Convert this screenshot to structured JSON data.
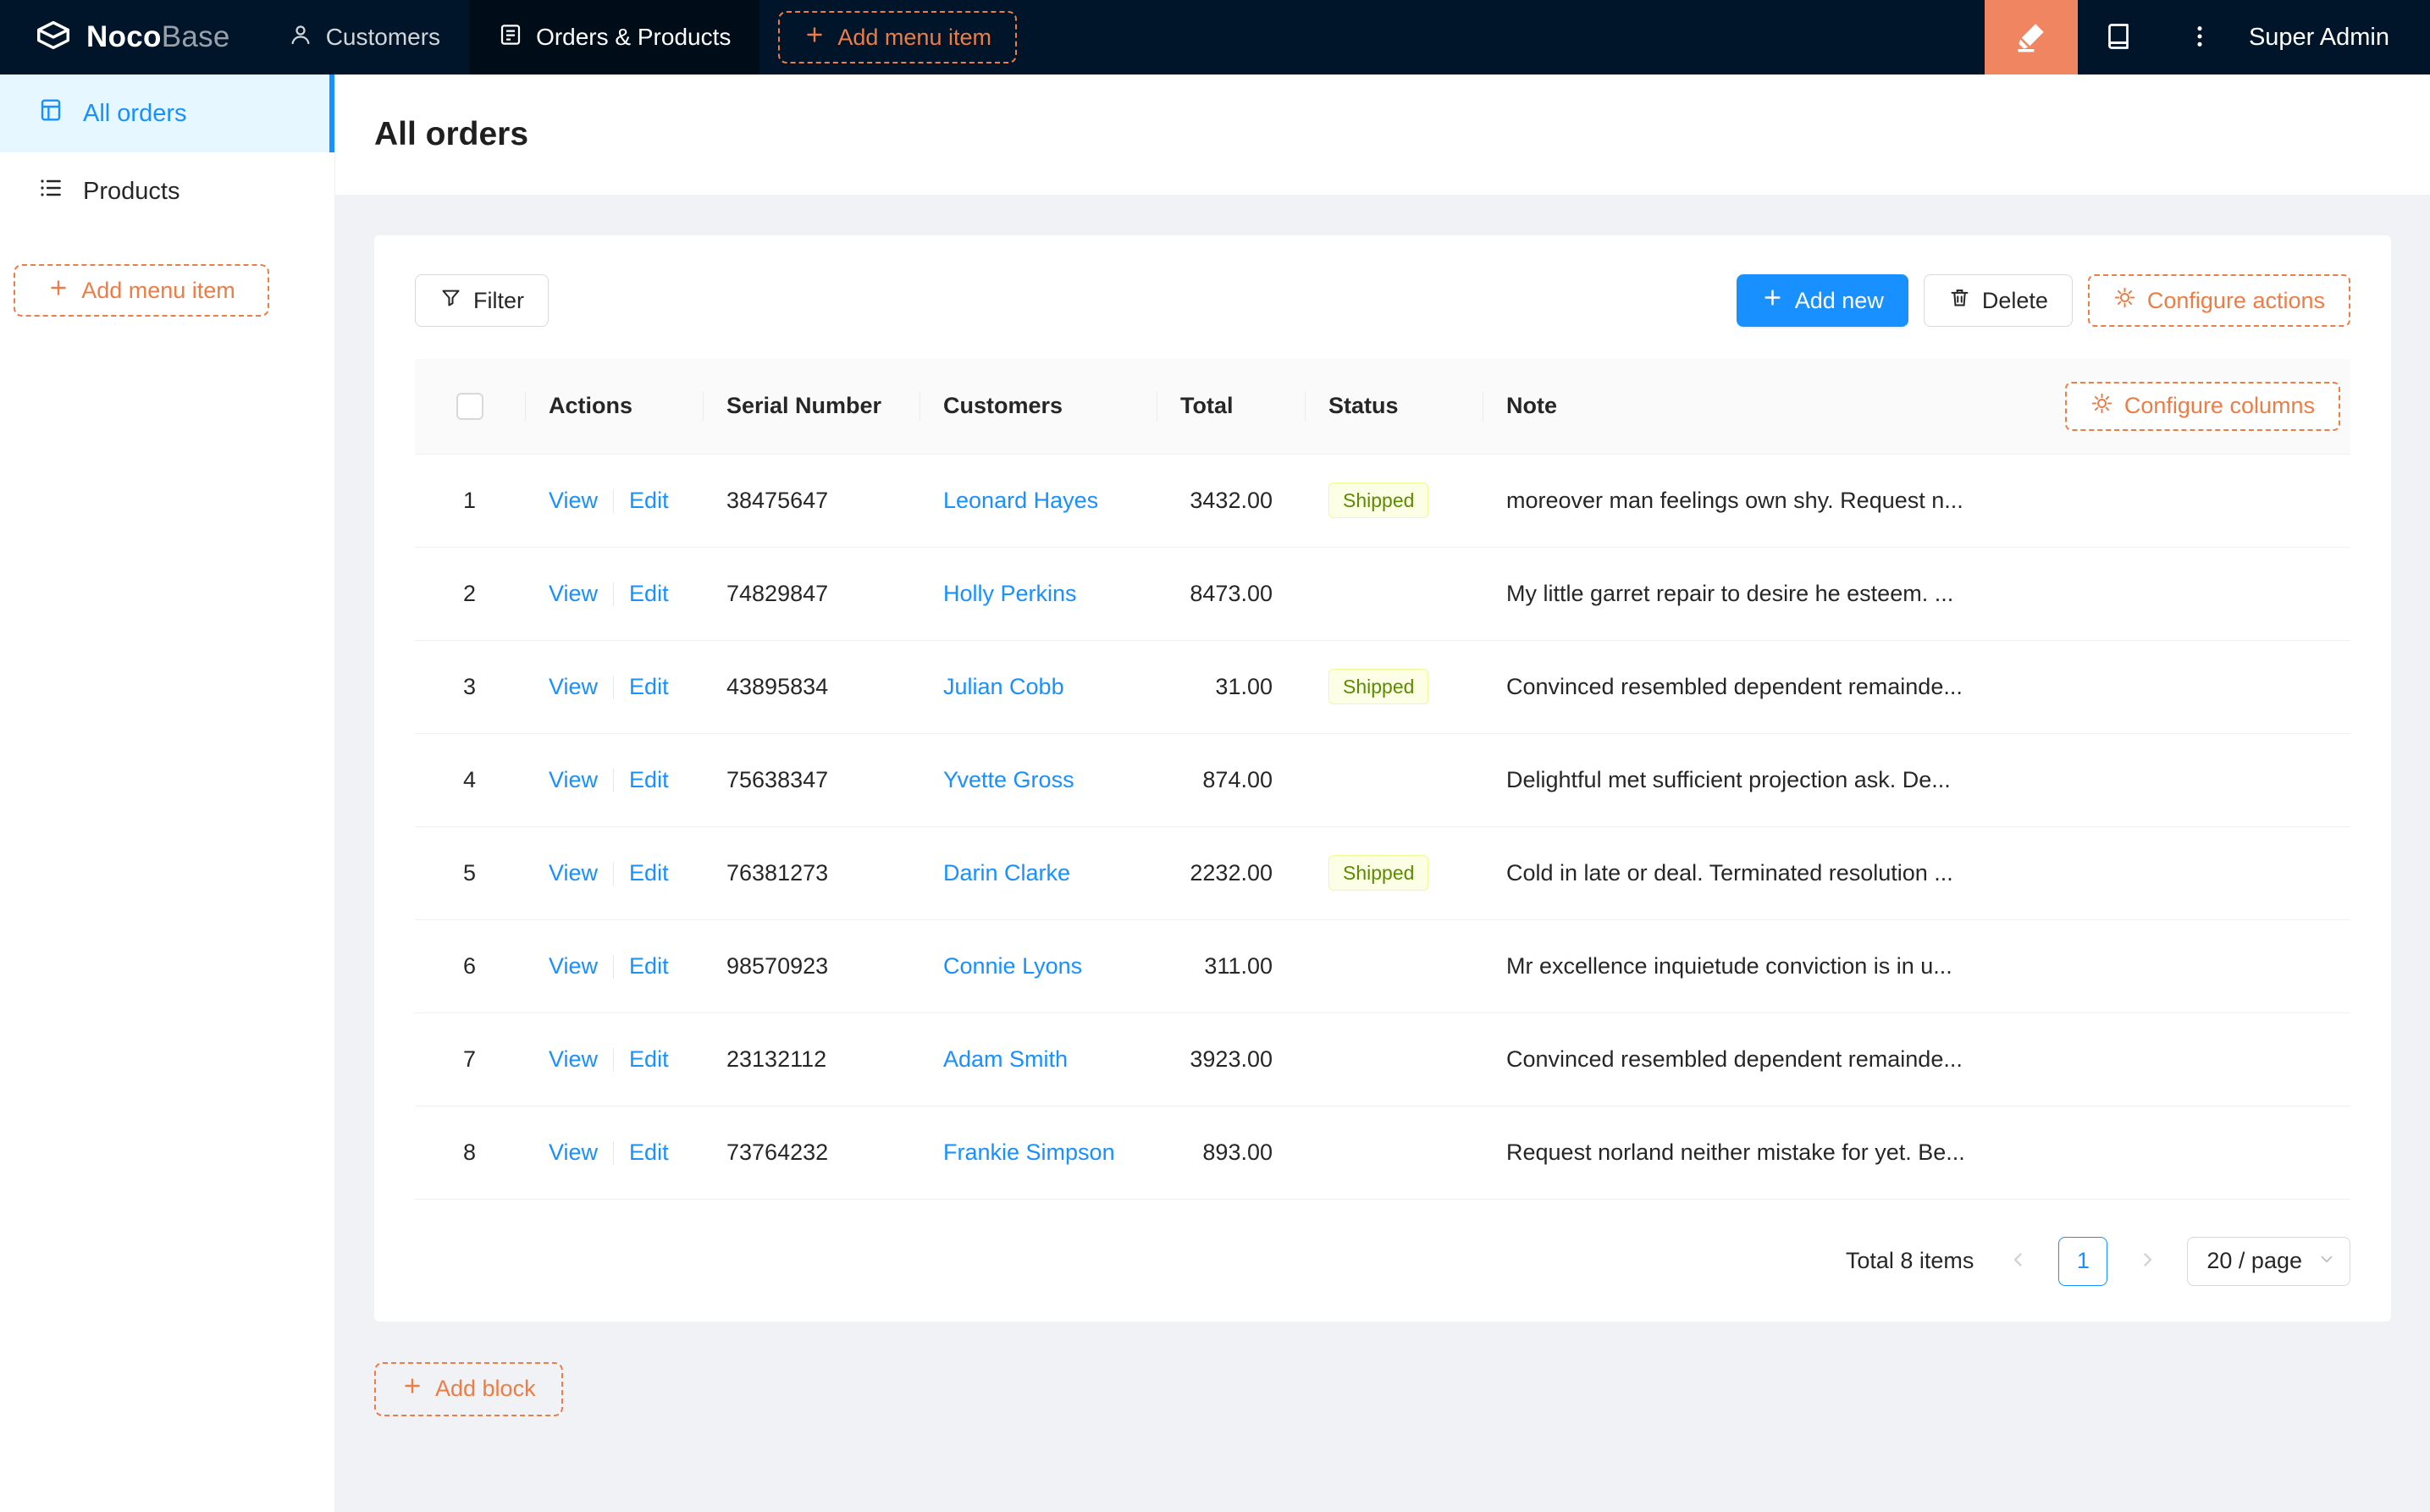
{
  "colors": {
    "navbar_bg": "#001529",
    "navbar_active_bg": "#000c17",
    "accent_orange": "#ed7d45",
    "editor_button_bg": "#ef8661",
    "primary_blue": "#1890ff",
    "sidebar_selected_bg": "#e6f7ff",
    "content_bg": "#f0f2f5",
    "badge_bg": "#fcffe6",
    "badge_border": "#eaff8f",
    "badge_text": "#5b8c00"
  },
  "navbar": {
    "logo": {
      "bold": "Noco",
      "light": "Base"
    },
    "menu": [
      {
        "label": "Customers"
      },
      {
        "label": "Orders & Products"
      }
    ],
    "add_menu_item_label": "Add menu item",
    "user": "Super Admin"
  },
  "sidebar": {
    "items": [
      {
        "label": "All orders"
      },
      {
        "label": "Products"
      }
    ],
    "add_menu_item_label": "Add menu item"
  },
  "page": {
    "title": "All orders",
    "toolbar": {
      "filter": "Filter",
      "add_new": "Add new",
      "delete": "Delete",
      "configure_actions": "Configure actions"
    },
    "table": {
      "configure_columns": "Configure columns",
      "columns": [
        "Actions",
        "Serial Number",
        "Customers",
        "Total",
        "Status",
        "Note"
      ],
      "action_labels": {
        "view": "View",
        "edit": "Edit"
      },
      "rows": [
        {
          "index": 1,
          "serial": "38475647",
          "customer": "Leonard Hayes",
          "total": "3432.00",
          "status": "Shipped",
          "note": "moreover man feelings own shy. Request n..."
        },
        {
          "index": 2,
          "serial": "74829847",
          "customer": "Holly Perkins",
          "total": "8473.00",
          "status": "",
          "note": "My little garret repair to desire he esteem. ..."
        },
        {
          "index": 3,
          "serial": "43895834",
          "customer": "Julian Cobb",
          "total": "31.00",
          "status": "Shipped",
          "note": "Convinced resembled dependent remainde..."
        },
        {
          "index": 4,
          "serial": "75638347",
          "customer": "Yvette Gross",
          "total": "874.00",
          "status": "",
          "note": "Delightful met sufficient projection ask. De..."
        },
        {
          "index": 5,
          "serial": "76381273",
          "customer": "Darin Clarke",
          "total": "2232.00",
          "status": "Shipped",
          "note": "Cold in late or deal. Terminated resolution ..."
        },
        {
          "index": 6,
          "serial": "98570923",
          "customer": "Connie Lyons",
          "total": "311.00",
          "status": "",
          "note": "Mr excellence inquietude conviction is in u..."
        },
        {
          "index": 7,
          "serial": "23132112",
          "customer": "Adam Smith",
          "total": "3923.00",
          "status": "",
          "note": "Convinced resembled dependent remainde..."
        },
        {
          "index": 8,
          "serial": "73764232",
          "customer": "Frankie Simpson",
          "total": "893.00",
          "status": "",
          "note": "Request norland neither mistake for yet. Be..."
        }
      ],
      "pagination": {
        "total_text": "Total 8 items",
        "current_page": "1",
        "page_size": "20 / page"
      }
    },
    "add_block_label": "Add block"
  }
}
